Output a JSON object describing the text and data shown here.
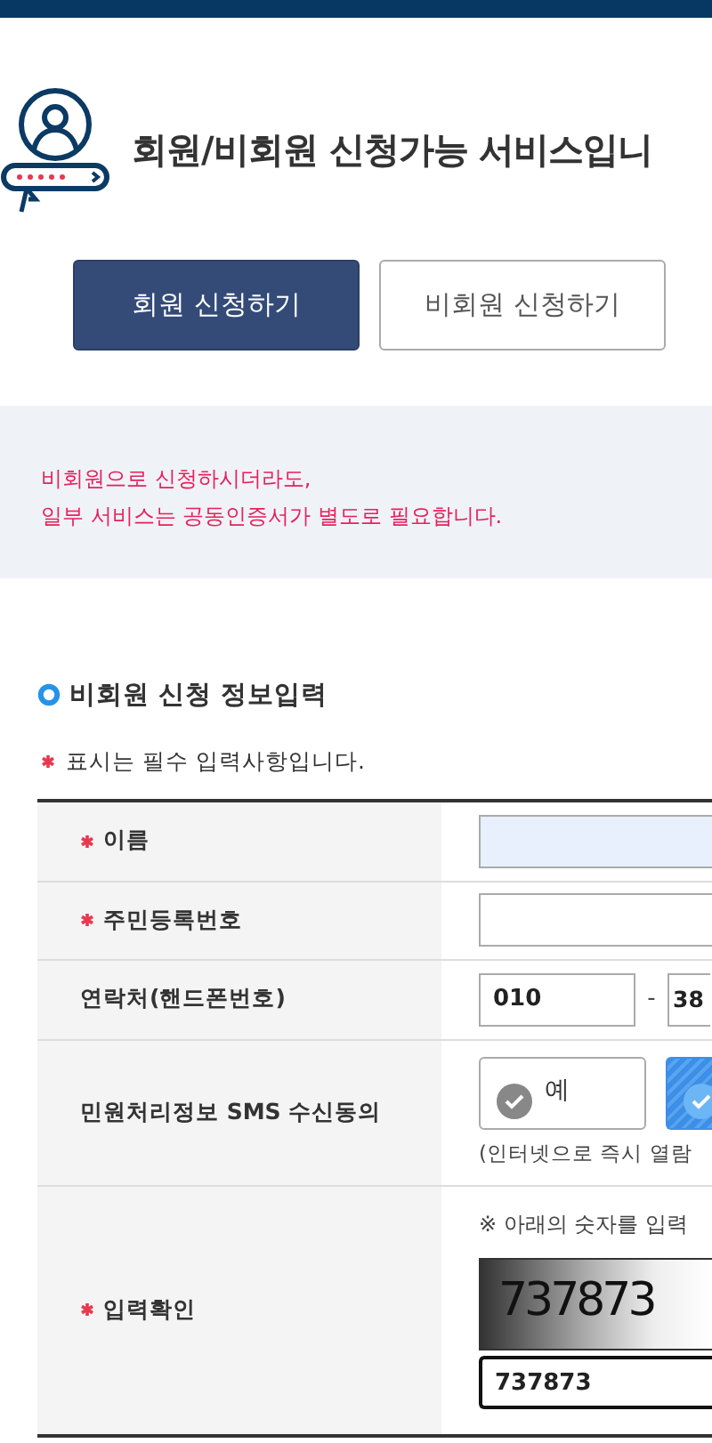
{
  "header": {
    "title": "회원/비회원 신청가능 서비스입니"
  },
  "member_tabs": [
    {
      "label": "회원 신청하기",
      "selected": true
    },
    {
      "label": "비회원 신청하기",
      "selected": false
    }
  ],
  "notice": [
    "비회원으로 신청하시더라도,",
    "일부 서비스는 공동인증서가 별도로 필요합니다."
  ],
  "section_title": "비회원 신청 정보입력",
  "required_note": "표시는 필수 입력사항입니다.",
  "rows": [
    {
      "kind": "text",
      "label": "이름",
      "required": true,
      "autofilled": true
    },
    {
      "kind": "text",
      "label": "주민등록번호",
      "required": true,
      "autofilled": false
    },
    {
      "kind": "phone",
      "label": "연락처(핸드폰번호)",
      "required": false,
      "parts": [
        "010",
        "38"
      ],
      "separator": "-"
    },
    {
      "kind": "choice",
      "label": "민원처리정보 SMS 수신동의",
      "required": false,
      "options": [
        {
          "label": "예",
          "selected": false
        },
        {
          "selected": true
        }
      ],
      "note": "(인터넷으로 즉시 열람"
    },
    {
      "kind": "captcha",
      "label": "입력확인",
      "required": true,
      "hint": "※ 아래의 숫자를 입력",
      "captcha_text": "737873",
      "value": "737873"
    }
  ]
}
